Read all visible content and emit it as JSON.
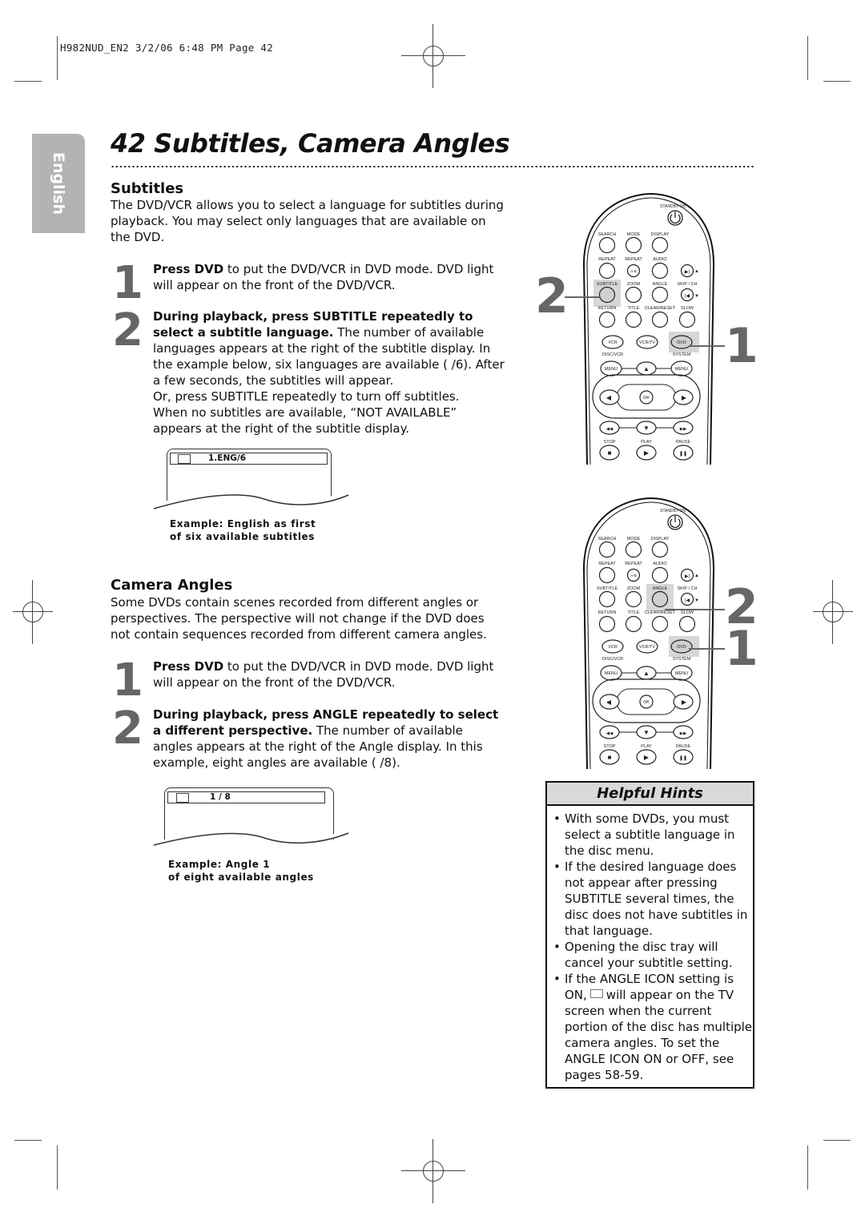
{
  "header": {
    "slug": "H982NUD_EN2  3/2/06  6:48 PM  Page 42"
  },
  "side_tab": {
    "label": "English"
  },
  "page": {
    "number": "42",
    "title": "42  Subtitles, Camera Angles"
  },
  "subtitles": {
    "heading": "Subtitles",
    "intro": "The DVD/VCR allows you to select a language for subtitles during playback. You may select only languages that are available on the DVD.",
    "steps": [
      {
        "num": "1",
        "bold": "Press DVD",
        "text": " to put the DVD/VCR in DVD mode. DVD light will appear on the front of the DVD/VCR."
      },
      {
        "num": "2",
        "bold": "During playback, press SUBTITLE repeatedly to select a subtitle language.",
        "text": " The number of available languages appears at the right of the subtitle display. In the example below, six languages are available (  /6). After a few seconds, the subtitles will appear.",
        "extra": "Or, press SUBTITLE repeatedly to turn off subtitles. When no subtitles are available, “NOT AVAILABLE” appears at the right of the subtitle display."
      }
    ],
    "osd": {
      "icon": "subtitle-icon",
      "value": "1.ENG/6"
    },
    "caption_line1": "Example: English as first",
    "caption_line2": "of six available subtitles"
  },
  "camera_angles": {
    "heading": "Camera Angles",
    "intro": "Some DVDs contain scenes recorded from different angles or perspectives. The perspective will not change if the DVD does not contain sequences recorded from different camera angles.",
    "steps": [
      {
        "num": "1",
        "bold": "Press DVD",
        "text": " to put the DVD/VCR in DVD mode. DVD light will appear on the front of the DVD/VCR."
      },
      {
        "num": "2",
        "bold": "During playback, press ANGLE repeatedly to select a different perspective.",
        "text": " The number of available angles appears at the right of the Angle display. In this example, eight angles are available (  /8)."
      }
    ],
    "osd": {
      "icon": "camera-angle-icon",
      "value": "1 / 8"
    },
    "caption_line1": "Example: Angle 1",
    "caption_line2": "of eight available angles"
  },
  "remote": {
    "standby": "STANDBY-ON",
    "row1": [
      "SEARCH",
      "MODE",
      "DISPLAY"
    ],
    "row2": [
      "REPEAT",
      "REPEAT",
      "AUDIO"
    ],
    "ab": "A-B",
    "row3": [
      "SUBTITLE",
      "ZOOM",
      "ANGLE",
      "SKIP / CH"
    ],
    "row4": [
      "RETURN",
      "TITLE",
      "CLEAR/RESET",
      "SLOW"
    ],
    "modes": [
      "VCR",
      "VCR/TV",
      "DVD"
    ],
    "disc_vcr": "DISC/VCR",
    "system": "SYSTEM",
    "menu": "MENU",
    "ok": "OK",
    "transport": [
      "STOP",
      "PLAY",
      "PAUSE"
    ]
  },
  "remote_callouts_top": [
    {
      "num": "2",
      "target": "SUBTITLE"
    },
    {
      "num": "1",
      "target": "DVD"
    }
  ],
  "remote_callouts_bottom": [
    {
      "num": "2",
      "target": "ANGLE"
    },
    {
      "num": "1",
      "target": "DVD"
    }
  ],
  "hints": {
    "title": "Helpful Hints",
    "items": [
      "With some DVDs, you must select a subtitle language in the disc menu.",
      "If the desired language does not appear after pressing SUBTITLE several times, the disc does not have subtitles in that language.",
      "Opening the disc tray will cancel your subtitle setting."
    ],
    "last_item_a": "If the ANGLE ICON setting is ON,",
    "last_item_b": "will appear on the TV screen when the current portion of the disc has multiple camera angles. To set the ANGLE ICON ON or OFF, see pages 58-59."
  }
}
